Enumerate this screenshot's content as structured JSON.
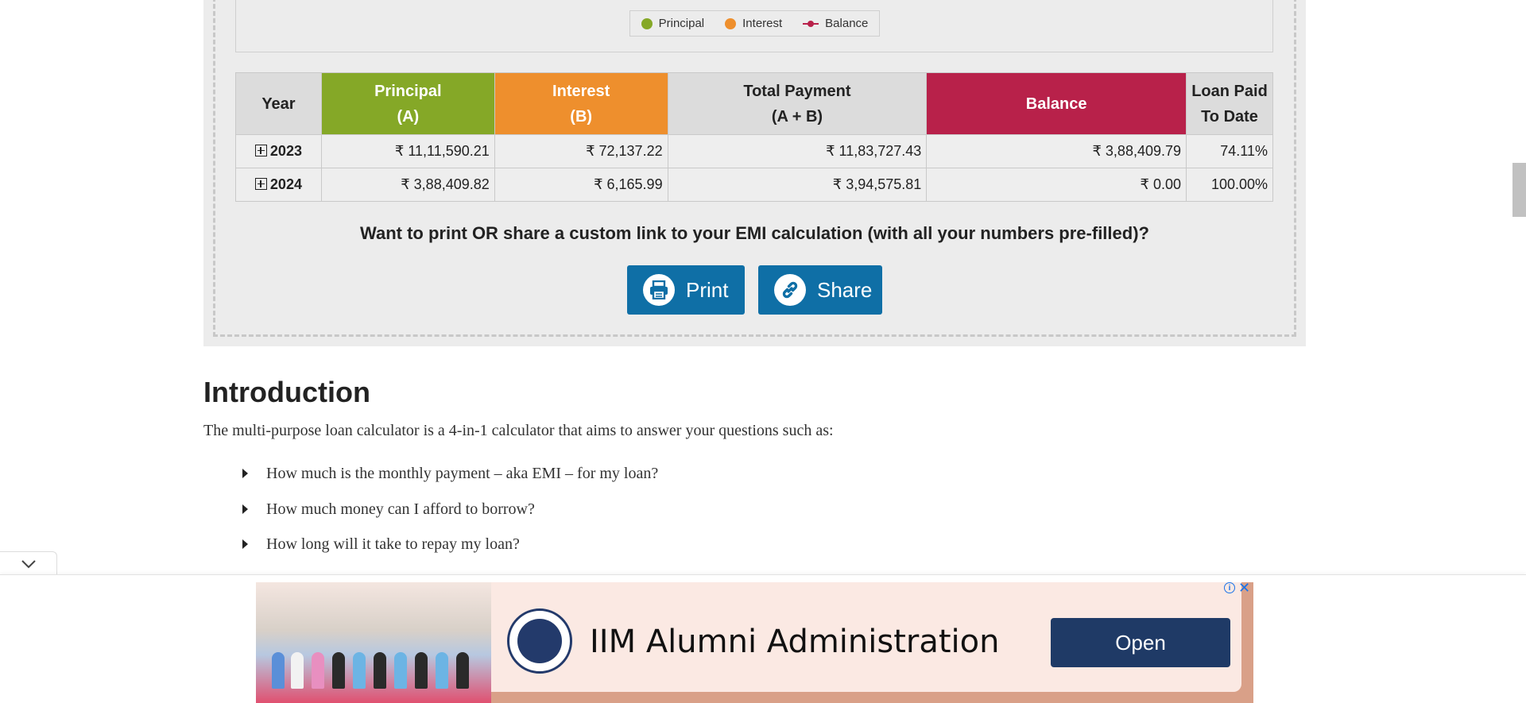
{
  "legend": {
    "principal": "Principal",
    "interest": "Interest",
    "balance": "Balance"
  },
  "table": {
    "headers": {
      "year": "Year",
      "principal_line1": "Principal",
      "principal_line2": "(A)",
      "interest_line1": "Interest",
      "interest_line2": "(B)",
      "total_line1": "Total Payment",
      "total_line2": "(A + B)",
      "balance": "Balance",
      "paid_line1": "Loan Paid",
      "paid_line2": "To Date"
    },
    "rows": [
      {
        "year": "2023",
        "principal": "₹ 11,11,590.21",
        "interest": "₹ 72,137.22",
        "total": "₹ 11,83,727.43",
        "balance": "₹ 3,88,409.79",
        "paid": "74.11%"
      },
      {
        "year": "2024",
        "principal": "₹ 3,88,409.82",
        "interest": "₹ 6,165.99",
        "total": "₹ 3,94,575.81",
        "balance": "₹ 0.00",
        "paid": "100.00%"
      }
    ]
  },
  "share_prompt": "Want to print OR share a custom link to your EMI calculation (with all your numbers pre-filled)?",
  "buttons": {
    "print": "Print",
    "share": "Share"
  },
  "intro": {
    "title": "Introduction",
    "text": "The multi-purpose loan calculator is a 4-in-1 calculator that aims to answer your questions such as:",
    "bullets": [
      "How much is the monthly payment – aka EMI – for my loan?",
      "How much money can I afford to borrow?",
      "How long will it take to repay my loan?"
    ]
  },
  "ad": {
    "headline": "IIM Alumni Administration",
    "cta": "Open",
    "info_glyph": "i",
    "close_glyph": "✕"
  },
  "colors": {
    "principal": "#85a827",
    "interest": "#ee8f2d",
    "balance": "#b8214a",
    "button": "#0f6fa6"
  }
}
